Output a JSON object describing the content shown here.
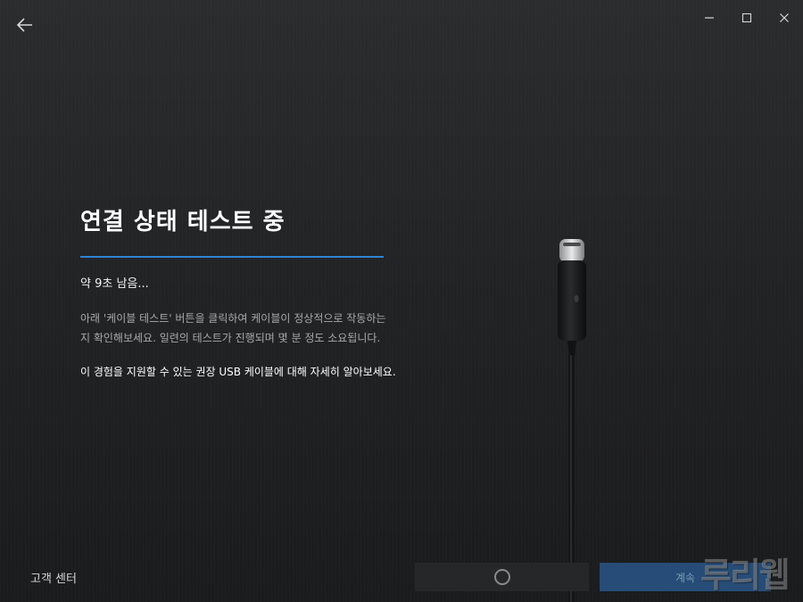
{
  "header": {
    "back_icon": "arrow-left-icon",
    "window_controls": {
      "minimize_icon": "minimize-icon",
      "maximize_icon": "maximize-icon",
      "close_icon": "close-icon"
    }
  },
  "main": {
    "title": "연결 상태 테스트 중",
    "countdown": "약 9초 남음...",
    "description": "아래 '케이블 테스트' 버튼을 클릭하여 케이블이 정상적으로 작동하는지 확인해보세요. 일련의 테스트가 진행되며 몇 분 정도 소요됩니다.",
    "learn_more": "이 경험을 지원할 수 있는 권장 USB 케이블에 대해 자세히 알아보세요.",
    "accent_color": "#2f83d6"
  },
  "footer": {
    "support_label": "고객 센터",
    "cable_test_state_icon": "loading-spinner-icon",
    "next_label": "계속",
    "next_color": "#264c77"
  },
  "watermark": {
    "text": "루리웹"
  }
}
